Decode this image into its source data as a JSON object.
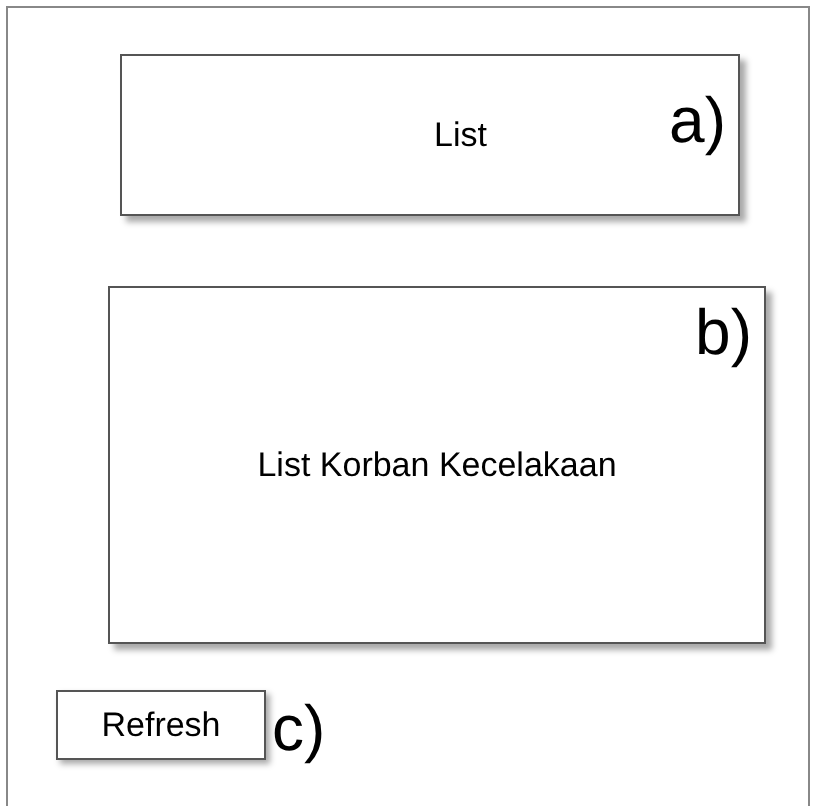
{
  "panels": [
    {
      "text": "List",
      "label": "a)"
    },
    {
      "text": "List Korban Kecelakaan",
      "label": "b)"
    }
  ],
  "refresh": {
    "label": "Refresh",
    "marker": "c)"
  }
}
